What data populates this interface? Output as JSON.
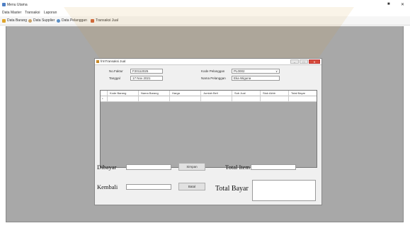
{
  "window": {
    "title": "Menu Utama",
    "minimize": "■",
    "close": "✕"
  },
  "menu": {
    "items": [
      "Data Master",
      "Transaksi",
      "Laporan"
    ]
  },
  "toolbar": {
    "items": [
      {
        "label": "Data Barang",
        "icon": "box-icon",
        "color": "#e0a52a"
      },
      {
        "label": "Data Supplier",
        "icon": "people-icon",
        "color": "#c9a26a"
      },
      {
        "label": "Data Pelanggan",
        "icon": "group-icon",
        "color": "#5a8fc7"
      },
      {
        "label": "Transaksi Jual",
        "icon": "cart-icon",
        "color": "#d0643a"
      }
    ]
  },
  "form": {
    "title": "frmTransaksi Jual",
    "buttons": {
      "minimize": "–",
      "maximize": "□",
      "close": "✕"
    },
    "no_faktur_label": "No.Faktur",
    "no_faktur_value": "F20112025",
    "tanggal_label": "Tanggal",
    "tanggal_value": "17 Nov 2021",
    "kode_pelanggan_label": "Kode Pelanggan",
    "kode_pelanggan_value": "PL0002",
    "nama_pelanggan_label": "Nama Pelanggan",
    "nama_pelanggan_value": "Eka Wiguna",
    "grid": {
      "columns": [
        "Kode Barang",
        "Nama Barang",
        "Harga",
        "Jumlah Beli",
        "Sub Jual",
        "Stok Akhir",
        "Total Bayar"
      ],
      "new_row_marker": "*"
    },
    "dibayar_label": "Dibayar",
    "kembali_label": "Kembali",
    "simpan_label": "Simpan",
    "batal_label": "Batal",
    "total_item_label": "Total Item",
    "total_bayar_label": "Total Bayar"
  }
}
